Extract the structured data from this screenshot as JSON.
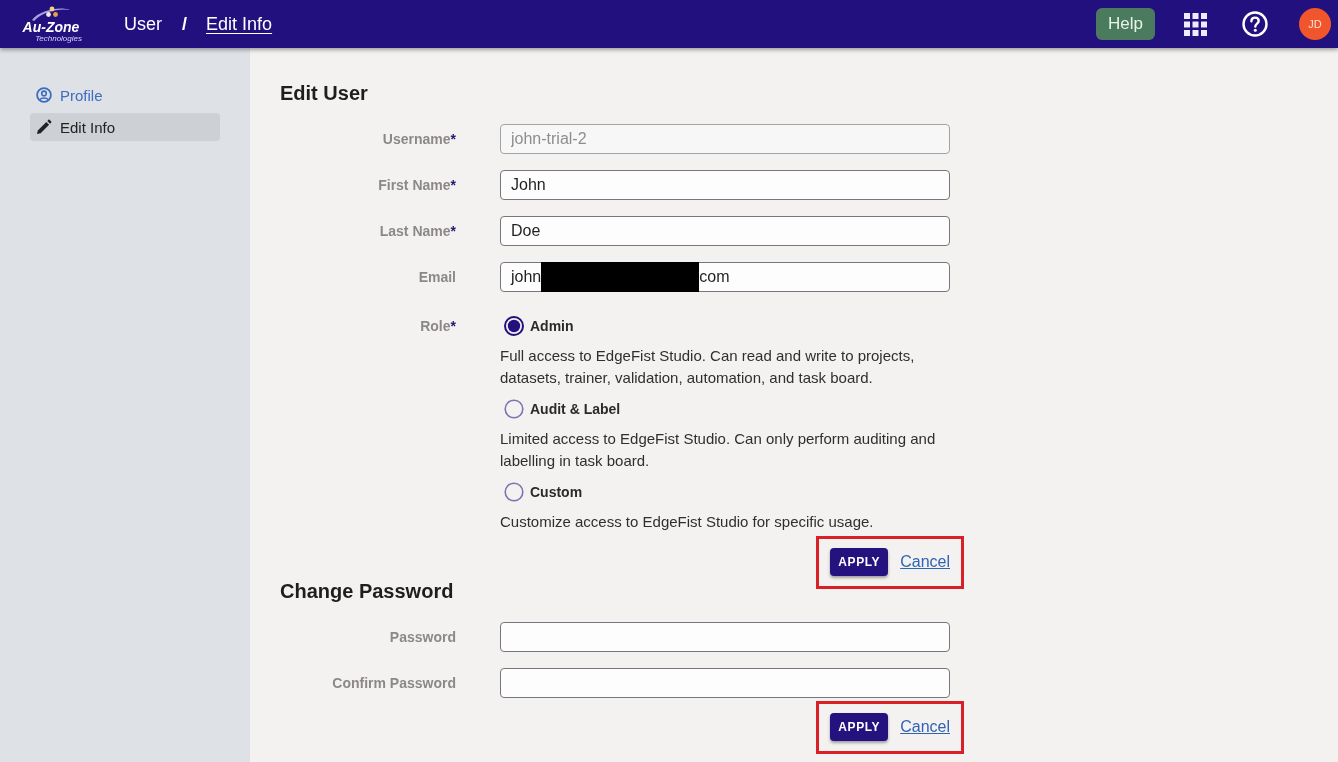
{
  "header": {
    "logo": {
      "name": "Au-Zone",
      "tagline": "Technologies"
    },
    "breadcrumb": [
      {
        "label": "User",
        "link": false
      },
      {
        "label": "Edit Info",
        "link": true
      }
    ],
    "breadcrumb_separator": "/",
    "help_button": "Help",
    "avatar": {
      "initials": "JD"
    }
  },
  "sidebar": {
    "items": [
      {
        "kind": "profile",
        "label": "Profile",
        "selected": false
      },
      {
        "kind": "edit",
        "label": "Edit Info",
        "selected": true
      }
    ]
  },
  "edit_user": {
    "title": "Edit User",
    "fields": [
      {
        "label": "Username",
        "required_mark": "*",
        "value": "john-trial-2",
        "disabled": true
      },
      {
        "label": "First Name",
        "required_mark": "*",
        "value": "John",
        "disabled": false
      },
      {
        "label": "Last Name",
        "required_mark": "*",
        "value": "Doe",
        "disabled": false
      },
      {
        "label": "Email",
        "value": "john",
        "redacted": true,
        "value_after_redaction": "com",
        "disabled": false
      }
    ],
    "role": {
      "label": "Role",
      "required_mark": "*",
      "options": [
        {
          "label": "Admin",
          "description": "Full access to EdgeFist Studio. Can read and write to projects, datasets, trainer, validation, automation, and task board.",
          "selected": true
        },
        {
          "label": "Audit & Label",
          "description": "Limited access to EdgeFist Studio. Can only perform auditing and labelling in task board.",
          "selected": false
        },
        {
          "label": "Custom",
          "description": "Customize access to EdgeFist Studio for specific usage.",
          "selected": false
        }
      ]
    },
    "actions": {
      "apply": "APPLY",
      "cancel": "Cancel",
      "highlighted": true
    }
  },
  "change_password": {
    "title": "Change Password",
    "fields": [
      {
        "label": "Password",
        "disabled": false
      },
      {
        "label": "Confirm Password",
        "disabled": false
      }
    ],
    "actions": {
      "apply": "APPLY",
      "cancel": "Cancel",
      "highlighted": true
    }
  }
}
